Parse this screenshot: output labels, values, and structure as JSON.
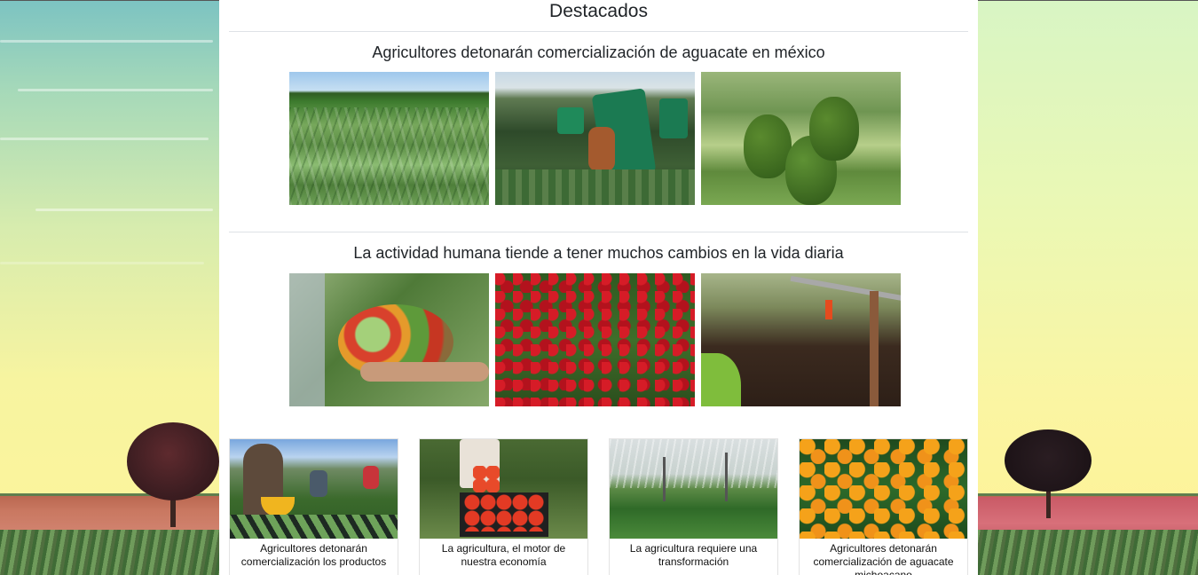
{
  "section": {
    "title": "Destacados"
  },
  "articles": [
    {
      "title": "Agricultores detonarán comercialización de aguacate en méxico",
      "images": [
        "corn-field-photo",
        "workers-harvesting-photo",
        "avocado-tree-photo"
      ]
    },
    {
      "title": "La actividad humana tiende a tener muchos cambios en la vida diaria",
      "images": [
        "vegetable-basket-photo",
        "coffee-cherries-photo",
        "drip-irrigation-photo"
      ]
    }
  ],
  "cards": [
    {
      "caption": "Agricultores detonarán comercialización los productos",
      "image": "farmers-harvest-photo"
    },
    {
      "caption": "La agricultura, el motor de nuestra economía",
      "image": "tomato-crate-photo"
    },
    {
      "caption": "La agricultura requiere una transformación",
      "image": "sprinkler-field-photo"
    },
    {
      "caption": "Agricultores detonarán comercialización de aguacate michoacano",
      "image": "orange-tree-photo"
    }
  ]
}
